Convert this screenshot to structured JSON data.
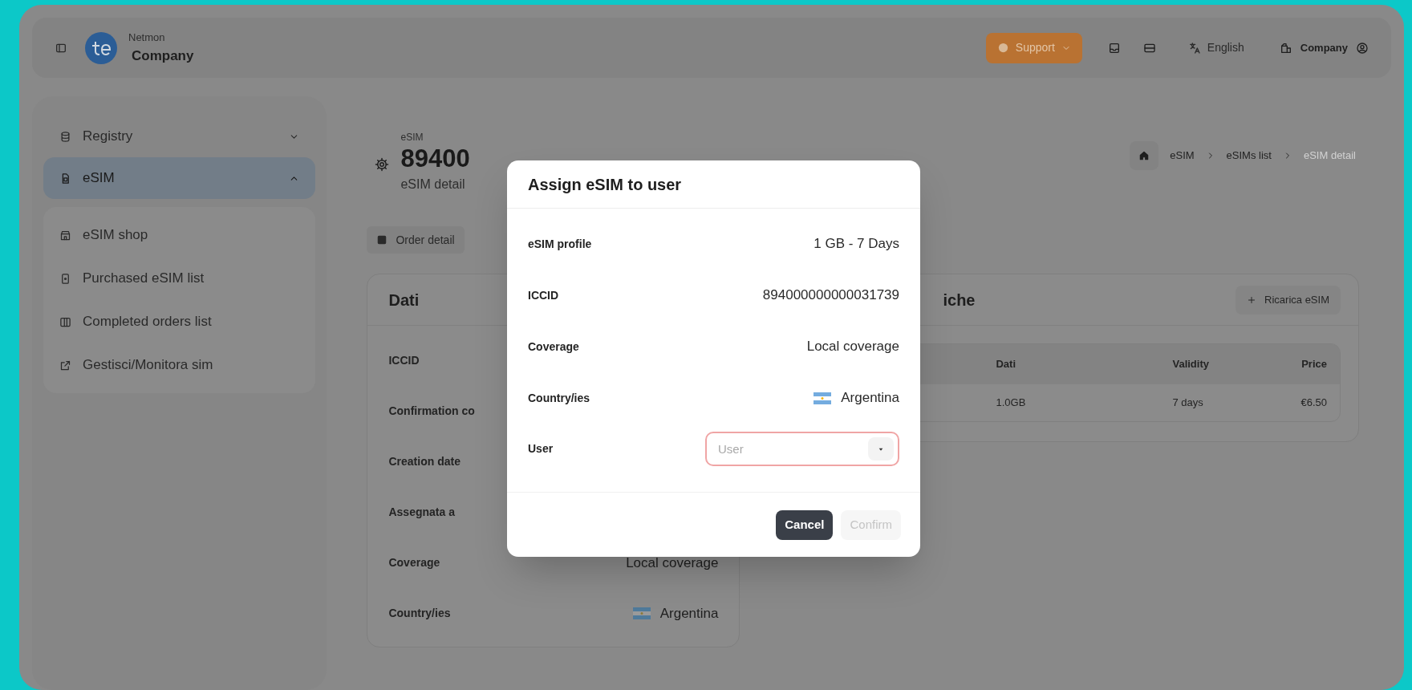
{
  "topbar": {
    "org": "Netmon",
    "company": "Company",
    "support": "Support",
    "language": "English",
    "account": "Company"
  },
  "sidebar": {
    "items": [
      {
        "label": "Registry",
        "expanded": false,
        "selected": false
      },
      {
        "label": "eSIM",
        "expanded": true,
        "selected": true,
        "children": [
          {
            "label": "eSIM shop"
          },
          {
            "label": "Purchased eSIM list"
          },
          {
            "label": "Completed orders list"
          },
          {
            "label": "Gestisci/Monitora sim"
          }
        ]
      }
    ]
  },
  "page": {
    "overline": "eSIM",
    "title": "89400",
    "subtitle": "eSIM detail",
    "breadcrumb": [
      {
        "label": "eSIM",
        "current": false
      },
      {
        "label": "eSIMs list",
        "current": false
      },
      {
        "label": "eSIM detail",
        "current": true
      }
    ],
    "tabs": [
      "Order detail"
    ]
  },
  "data_card": {
    "title": "Dati",
    "rows": [
      {
        "label": "ICCID"
      },
      {
        "label": "Confirmation co"
      },
      {
        "label": "Creation date"
      },
      {
        "label": "Assegnata a"
      },
      {
        "label": "Coverage",
        "value": "Local coverage",
        "kind": "text"
      },
      {
        "label": "Country/ies",
        "value": "Argentina",
        "kind": "country"
      }
    ]
  },
  "recharge_card": {
    "title": "iche",
    "button": "Ricarica eSIM",
    "columns": [
      "Dati",
      "Validity",
      "Price"
    ],
    "rows": [
      [
        "1.0GB",
        "7 days",
        "€6.50"
      ]
    ]
  },
  "modal": {
    "title": "Assign eSIM to user",
    "rows": [
      {
        "label": "eSIM profile",
        "value": "1 GB - 7 Days",
        "kind": "text"
      },
      {
        "label": "ICCID",
        "value": "894000000000031739",
        "kind": "text"
      },
      {
        "label": "Coverage",
        "value": "Local coverage",
        "kind": "text"
      },
      {
        "label": "Country/ies",
        "value": "Argentina",
        "kind": "country"
      }
    ],
    "user_field": {
      "label": "User",
      "placeholder": "User",
      "invalid": true
    },
    "buttons": [
      {
        "label": "Cancel",
        "kind": "primary",
        "disabled": false
      },
      {
        "label": "Confirm",
        "kind": "secondary",
        "disabled": true
      }
    ]
  }
}
